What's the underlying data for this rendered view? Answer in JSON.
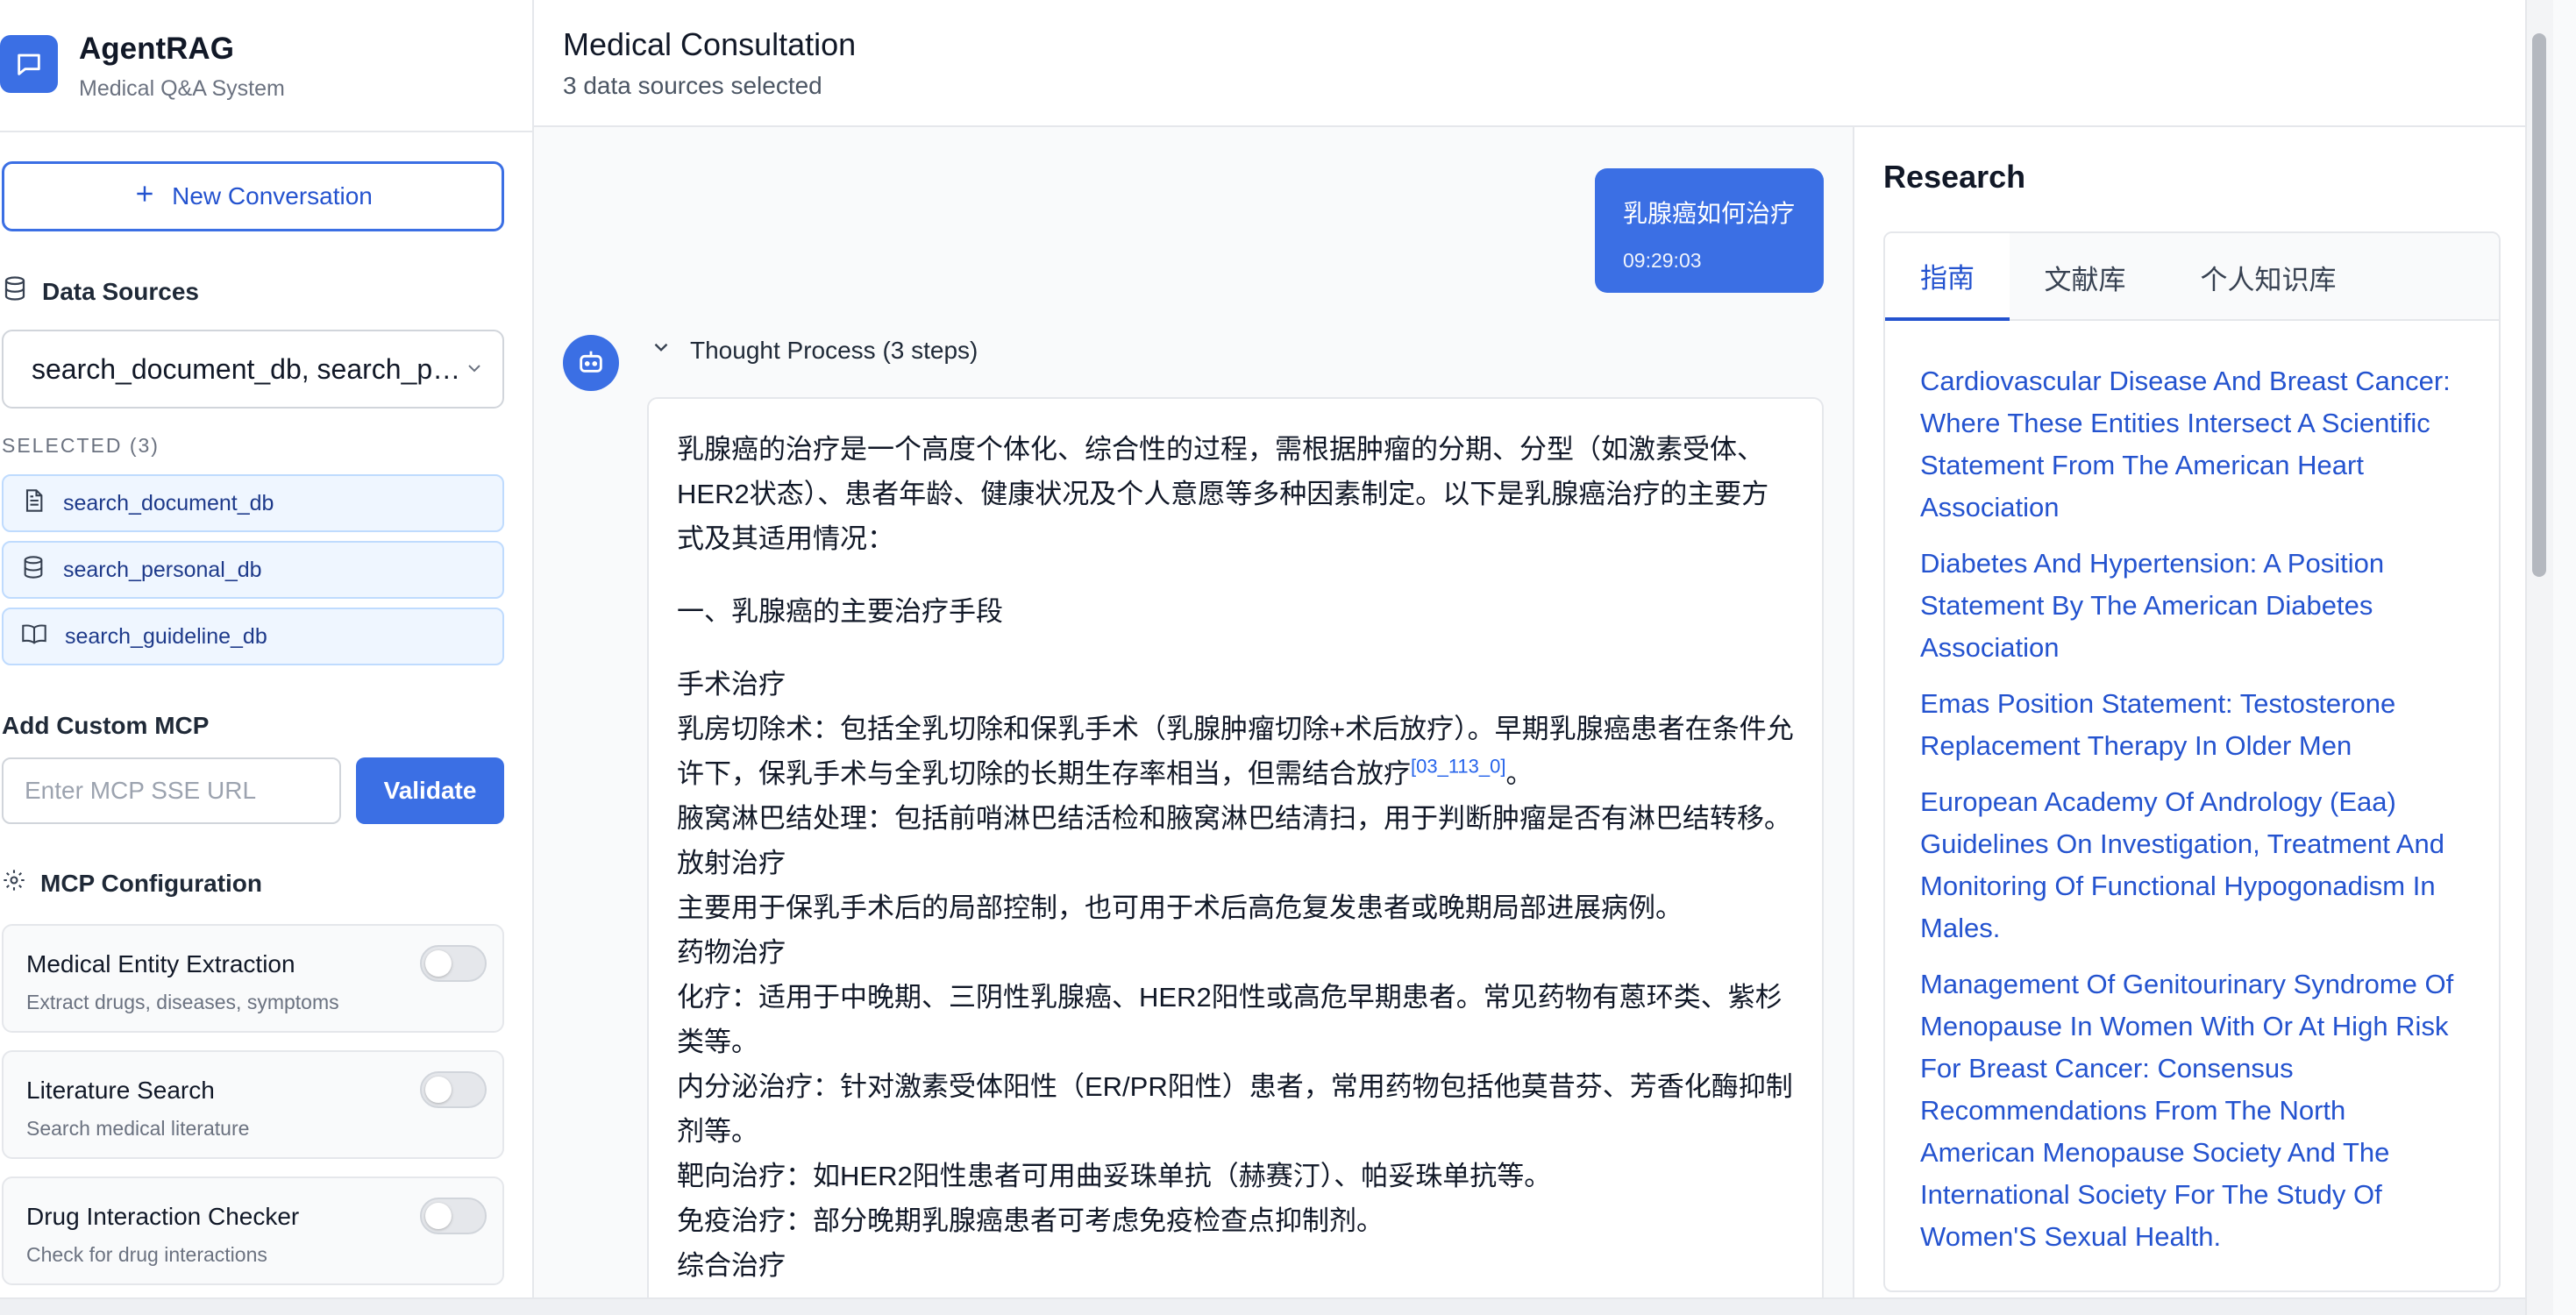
{
  "brand": {
    "name": "AgentRAG",
    "subtitle": "Medical Q&A System"
  },
  "sidebar": {
    "new_conversation": "New Conversation",
    "data_sources_title": "Data Sources",
    "select_value": "search_document_db, search_personal_db, search_guideline_db",
    "selected_label": "SELECTED (3)",
    "selected_items": [
      {
        "label": "search_document_db",
        "icon": "document-icon"
      },
      {
        "label": "search_personal_db",
        "icon": "database-icon"
      },
      {
        "label": "search_guideline_db",
        "icon": "book-icon"
      }
    ],
    "custom_mcp_title": "Add Custom MCP",
    "mcp_placeholder": "Enter MCP SSE URL",
    "validate_label": "Validate",
    "mcp_config_title": "MCP Configuration",
    "tools": [
      {
        "name": "Medical Entity Extraction",
        "desc": "Extract drugs, diseases, symptoms",
        "enabled": false
      },
      {
        "name": "Literature Search",
        "desc": "Search medical literature",
        "enabled": false
      },
      {
        "name": "Drug Interaction Checker",
        "desc": "Check for drug interactions",
        "enabled": false
      }
    ]
  },
  "header": {
    "title": "Medical Consultation",
    "subtitle": "3 data sources selected"
  },
  "chat": {
    "user_message": "乳腺癌如何治疗",
    "user_time": "09:29:03",
    "thought_label": "Thought Process (3 steps)",
    "answer": {
      "intro": "乳腺癌的治疗是一个高度个体化、综合性的过程，需根据肿瘤的分期、分型（如激素受体、HER2状态）、患者年龄、健康状况及个人意愿等多种因素制定。以下是乳腺癌治疗的主要方式及其适用情况：",
      "section1": "一、乳腺癌的主要治疗手段",
      "surgery_title": "手术治疗",
      "mastectomy": "乳房切除术：包括全乳切除和保乳手术（乳腺肿瘤切除+术后放疗）。早期乳腺癌患者在条件允许下，保乳手术与全乳切除的长期生存率相当，但需结合放疗",
      "mastectomy_cite": "[03_113_0]",
      "mastectomy_end": "。",
      "lymph": "腋窝淋巴结处理：包括前哨淋巴结活检和腋窝淋巴结清扫，用于判断肿瘤是否有淋巴结转移。",
      "radio_title": "放射治疗",
      "radio": "主要用于保乳手术后的局部控制，也可用于术后高危复发患者或晚期局部进展病例。",
      "drug_title": "药物治疗",
      "chemo": "化疗：适用于中晚期、三阴性乳腺癌、HER2阳性或高危早期患者。常见药物有蒽环类、紫杉类等。",
      "endocrine": "内分泌治疗：针对激素受体阳性（ER/PR阳性）患者，常用药物包括他莫昔芬、芳香化酶抑制剂等。",
      "targeted": "靶向治疗：如HER2阳性患者可用曲妥珠单抗（赫赛汀）、帕妥珠单抗等。",
      "immuno": "免疫治疗：部分晚期乳腺癌患者可考虑免疫检查点抑制剂。",
      "comprehensive": "综合治疗"
    }
  },
  "research": {
    "title": "Research",
    "tabs": [
      "指南",
      "文献库",
      "个人知识库"
    ],
    "active_tab": "指南",
    "references": [
      "Cardiovascular Disease And Breast Cancer: Where These Entities Intersect A Scientific Statement From The American Heart Association",
      "Diabetes And Hypertension: A Position Statement By The American Diabetes Association",
      "Emas Position Statement: Testosterone Replacement Therapy In Older Men",
      "European Academy Of Andrology (Eaa) Guidelines On Investigation, Treatment And Monitoring Of Functional Hypogonadism In Males.",
      "Management Of Genitourinary Syndrome Of Menopause In Women With Or At High Risk For Breast Cancer: Consensus Recommendations From The North American Menopause Society And The International Society For The Study Of Women'S Sexual Health."
    ]
  },
  "colors": {
    "accent": "#3b6fe4",
    "link": "#2453cf"
  }
}
